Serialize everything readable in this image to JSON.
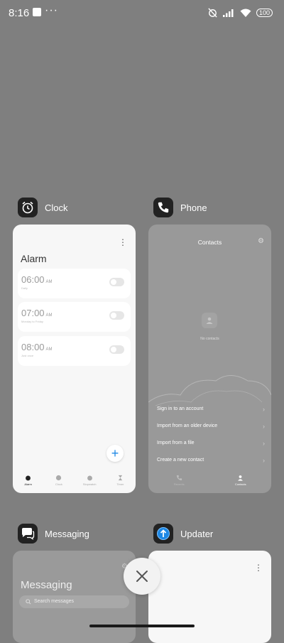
{
  "status": {
    "time": "8:16",
    "more": "···",
    "battery": "100"
  },
  "apps": {
    "clock": {
      "name": "Clock"
    },
    "phone": {
      "name": "Phone"
    },
    "messaging": {
      "name": "Messaging"
    },
    "updater": {
      "name": "Updater"
    }
  },
  "clock_card": {
    "title": "Alarm",
    "alarms": [
      {
        "time": "06:00",
        "ampm": "AM",
        "repeat": "Daily"
      },
      {
        "time": "07:00",
        "ampm": "AM",
        "repeat": "Monday to Friday"
      },
      {
        "time": "08:00",
        "ampm": "AM",
        "repeat": "Just once"
      }
    ],
    "nav": [
      "Alarm",
      "Clock",
      "Stopwatch",
      "Timer"
    ]
  },
  "phone_card": {
    "title": "Contacts",
    "empty_text": "No contacts",
    "options": [
      "Sign in to an account",
      "Import from an older device",
      "Import from a file",
      "Create a new contact"
    ],
    "nav": [
      "Recents",
      "Contacts"
    ]
  },
  "messaging_card": {
    "title": "Messaging",
    "search_placeholder": "Search messages"
  },
  "colors": {
    "background": "#7f7f7f",
    "accent": "#1e88e5"
  }
}
